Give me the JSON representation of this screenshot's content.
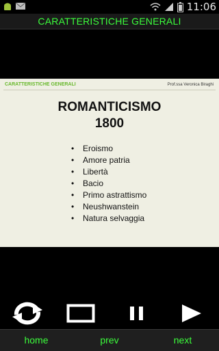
{
  "status": {
    "time": "11:06"
  },
  "app": {
    "title": "CARATTERISTICHE GENERALI"
  },
  "slide": {
    "header_left": "CARATTERISTICHE GENERALI",
    "header_right": "Prof.ssa Veronica Biraghi",
    "title_line1": "ROMANTICISMO",
    "title_line2": "1800",
    "bullets": [
      "Eroismo",
      "Amore patria",
      "Libertà",
      "Bacio",
      "Primo astrattismo",
      "Neushwanstein",
      "Natura selvaggia"
    ]
  },
  "controls": {
    "icons": [
      "refresh-icon",
      "stop-icon",
      "pause-icon",
      "play-icon"
    ]
  },
  "nav": {
    "home": "home",
    "prev": "prev",
    "next": "next"
  }
}
